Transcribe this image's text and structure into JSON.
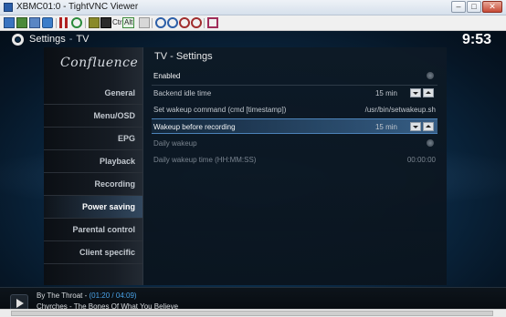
{
  "window": {
    "title": "XBMC01:0 - TightVNC Viewer",
    "controls": [
      "minimize",
      "maximize",
      "close"
    ]
  },
  "toolbar": {
    "icons": [
      "new-connection-icon",
      "save-icon",
      "options-icon",
      "info-icon",
      "pause-icon",
      "refresh-icon",
      "ctrl-alt-del-icon",
      "ctrl-esc-icon"
    ],
    "ctrl_label": "Ctrl",
    "alt_label": "Alt",
    "zoom_icons": [
      "zoom-in-icon",
      "zoom-out-icon",
      "zoom-fit-icon",
      "zoom-full-icon",
      "fullscreen-icon"
    ]
  },
  "header": {
    "section": "Settings",
    "separator": "-",
    "page": "TV",
    "clock": "9:53"
  },
  "menu": {
    "logo": "Confluence",
    "items": [
      {
        "label": "General",
        "active": false
      },
      {
        "label": "Menu/OSD",
        "active": false
      },
      {
        "label": "EPG",
        "active": false
      },
      {
        "label": "Playback",
        "active": false
      },
      {
        "label": "Recording",
        "active": false
      },
      {
        "label": "Power saving",
        "active": true
      },
      {
        "label": "Parental control",
        "active": false
      },
      {
        "label": "Client specific",
        "active": false
      }
    ]
  },
  "settings": {
    "title": "TV - Settings",
    "rows": [
      {
        "label": "Enabled",
        "value": "",
        "control": "radio"
      },
      {
        "label": "Backend idle time",
        "value": "15 min",
        "control": "spinner"
      },
      {
        "label": "Set wakeup command (cmd [timestamp])",
        "value": "/usr/bin/setwakeup.sh",
        "control": "text"
      },
      {
        "label": "Wakeup before recording",
        "value": "15 min",
        "control": "spinner"
      },
      {
        "label": "Daily wakeup",
        "value": "",
        "control": "radio"
      },
      {
        "label": "Daily wakeup time (HH:MM:SS)",
        "value": "00:00:00",
        "control": "text"
      }
    ]
  },
  "now_playing": {
    "line1_prefix": "By The Throat - ",
    "time": "(01:20 / 04:09)",
    "line2": "Chvrches - The Bones Of What You Believe"
  }
}
